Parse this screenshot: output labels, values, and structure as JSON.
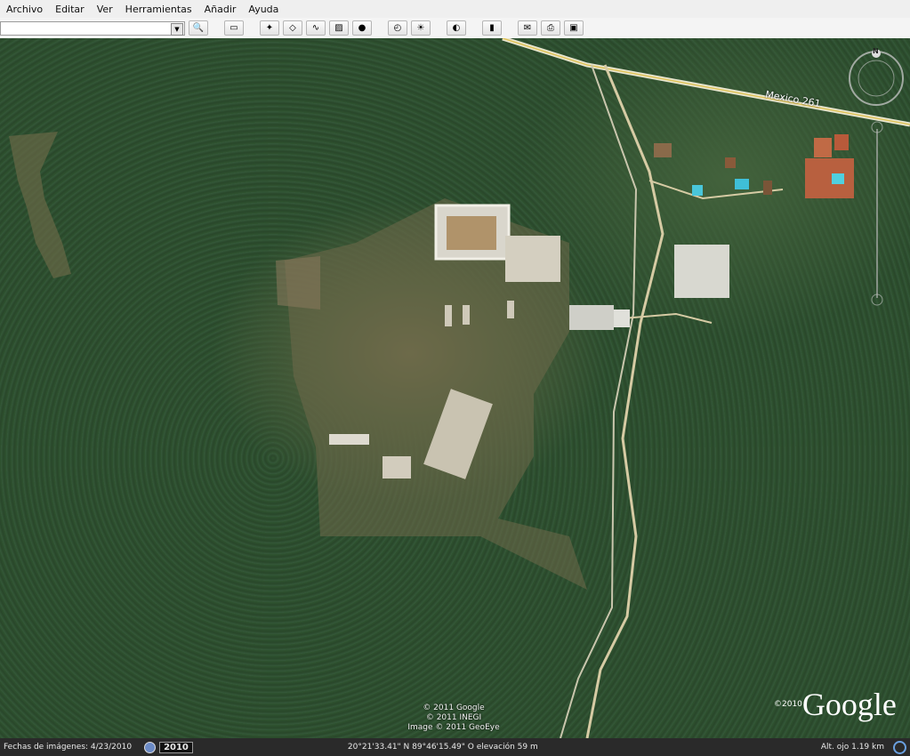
{
  "menu": [
    "Archivo",
    "Editar",
    "Ver",
    "Herramientas",
    "Añadir",
    "Ayuda"
  ],
  "toolbar": {
    "search_value": "",
    "buttons": [
      "search-icon",
      "sidebar-icon",
      "placemark-icon",
      "polygon-icon",
      "path-icon",
      "image-overlay-icon",
      "tour-icon",
      "historical-imagery-icon",
      "sunlight-icon",
      "planet-icon",
      "ruler-icon",
      "email-icon",
      "print-icon",
      "save-image-icon"
    ]
  },
  "map": {
    "road_label": "Mexico 261",
    "compass_north": "N",
    "copyright_lines": [
      "© 2011 Google",
      "© 2011 INEGI",
      "Image © 2011 GeoEye"
    ],
    "logo_year": "©2010",
    "logo_text": "Google"
  },
  "status": {
    "imagery_dates": "Fechas de imágenes: 4/23/2010",
    "year": "2010",
    "coordinates": "20°21'33.41\" N  89°46'15.49\" O  elevación   59 m",
    "eye_alt": "Alt. ojo    1.19 km"
  }
}
